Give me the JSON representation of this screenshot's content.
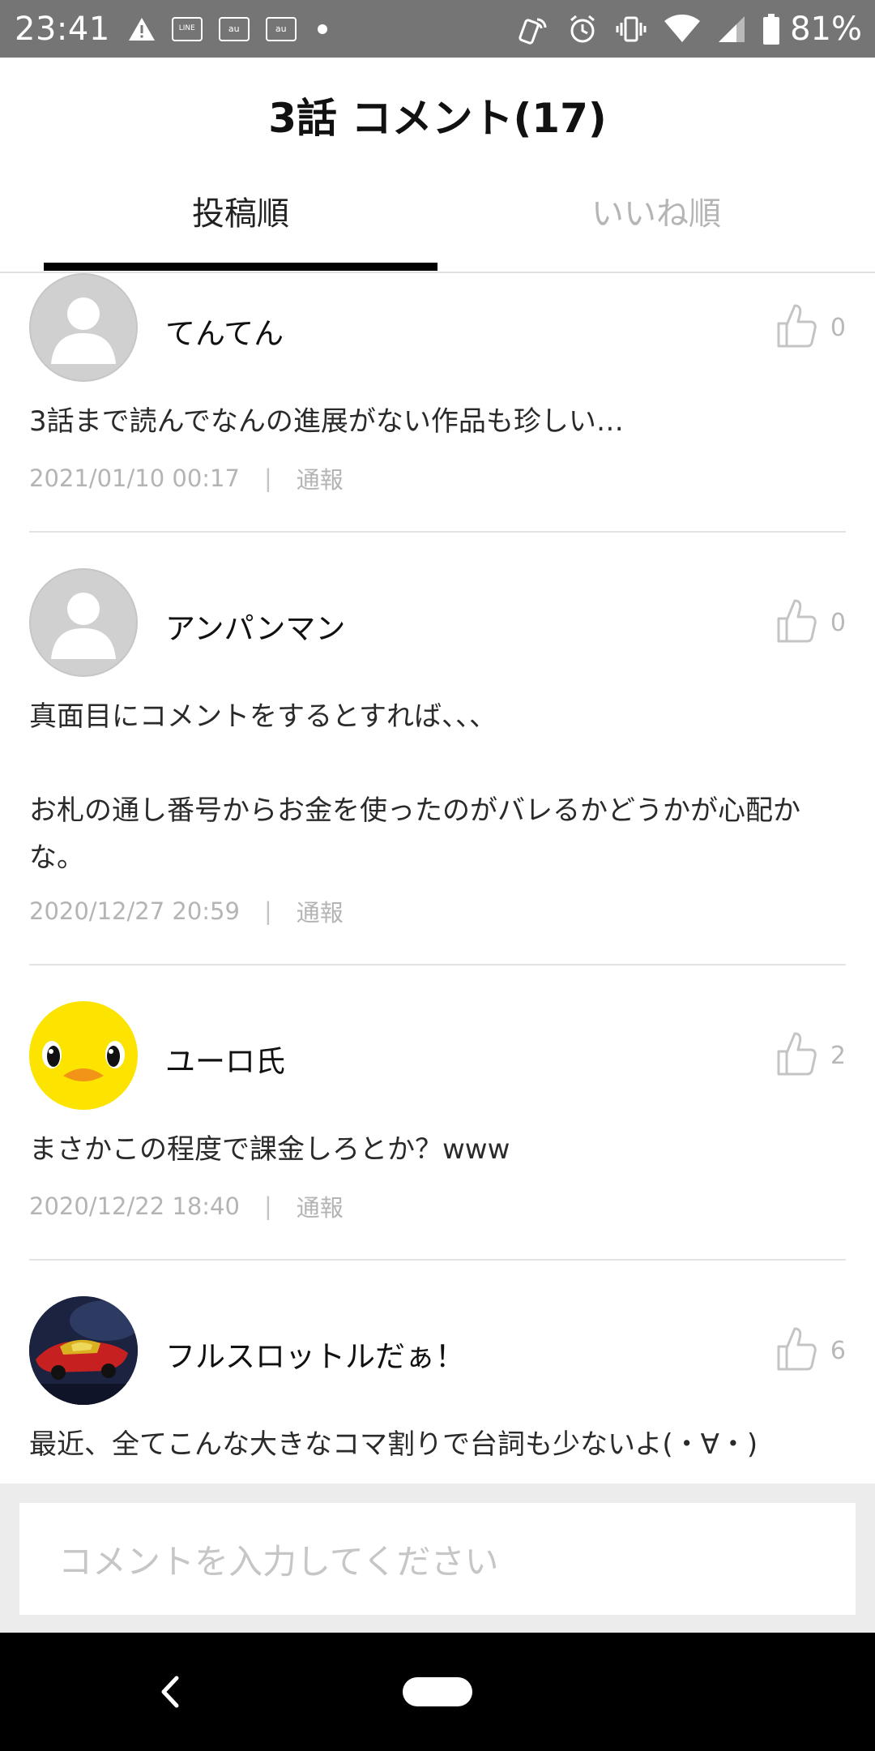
{
  "status_bar": {
    "time": "23:41",
    "battery": "81%",
    "badge_line": "LINE\nマンガ",
    "badge_au1": "au",
    "badge_au2": "au"
  },
  "header": {
    "title": "3話 コメント(17)",
    "tabs": [
      {
        "label": "投稿順",
        "selected": true
      },
      {
        "label": "いいね順",
        "selected": false
      }
    ]
  },
  "comments": [
    {
      "user": "てんてん",
      "avatar": "default-avatar-icon",
      "likes": "0",
      "text": "3話まで読んでなんの進展がない作品も珍しい…",
      "date": "2021/01/10 00:17",
      "report": "通報"
    },
    {
      "user": "アンパンマン",
      "avatar": "default-avatar-icon",
      "likes": "0",
      "text": "真面目にコメントをするとすれば、、、\n\nお札の通し番号からお金を使ったのがバレるかどうかが心配かな。",
      "date": "2020/12/27 20:59",
      "report": "通報"
    },
    {
      "user": "ユーロ氏",
      "avatar": "duck-avatar",
      "likes": "2",
      "text": "まさかこの程度で課金しろとか？www",
      "date": "2020/12/22 18:40",
      "report": "通報"
    },
    {
      "user": "フルスロットルだぁ！",
      "avatar": "car-photo-avatar",
      "likes": "6",
      "text": "最近、全てこんな大きなコマ割りで台詞も少ないよ(・∀・)",
      "date": "",
      "report": ""
    }
  ],
  "input": {
    "placeholder": "コメントを入力してください"
  },
  "colors": {
    "status_bar": "#757575",
    "tab_indicator": "#000000",
    "muted_text": "#b4b4b4",
    "input_area": "#ececec"
  }
}
